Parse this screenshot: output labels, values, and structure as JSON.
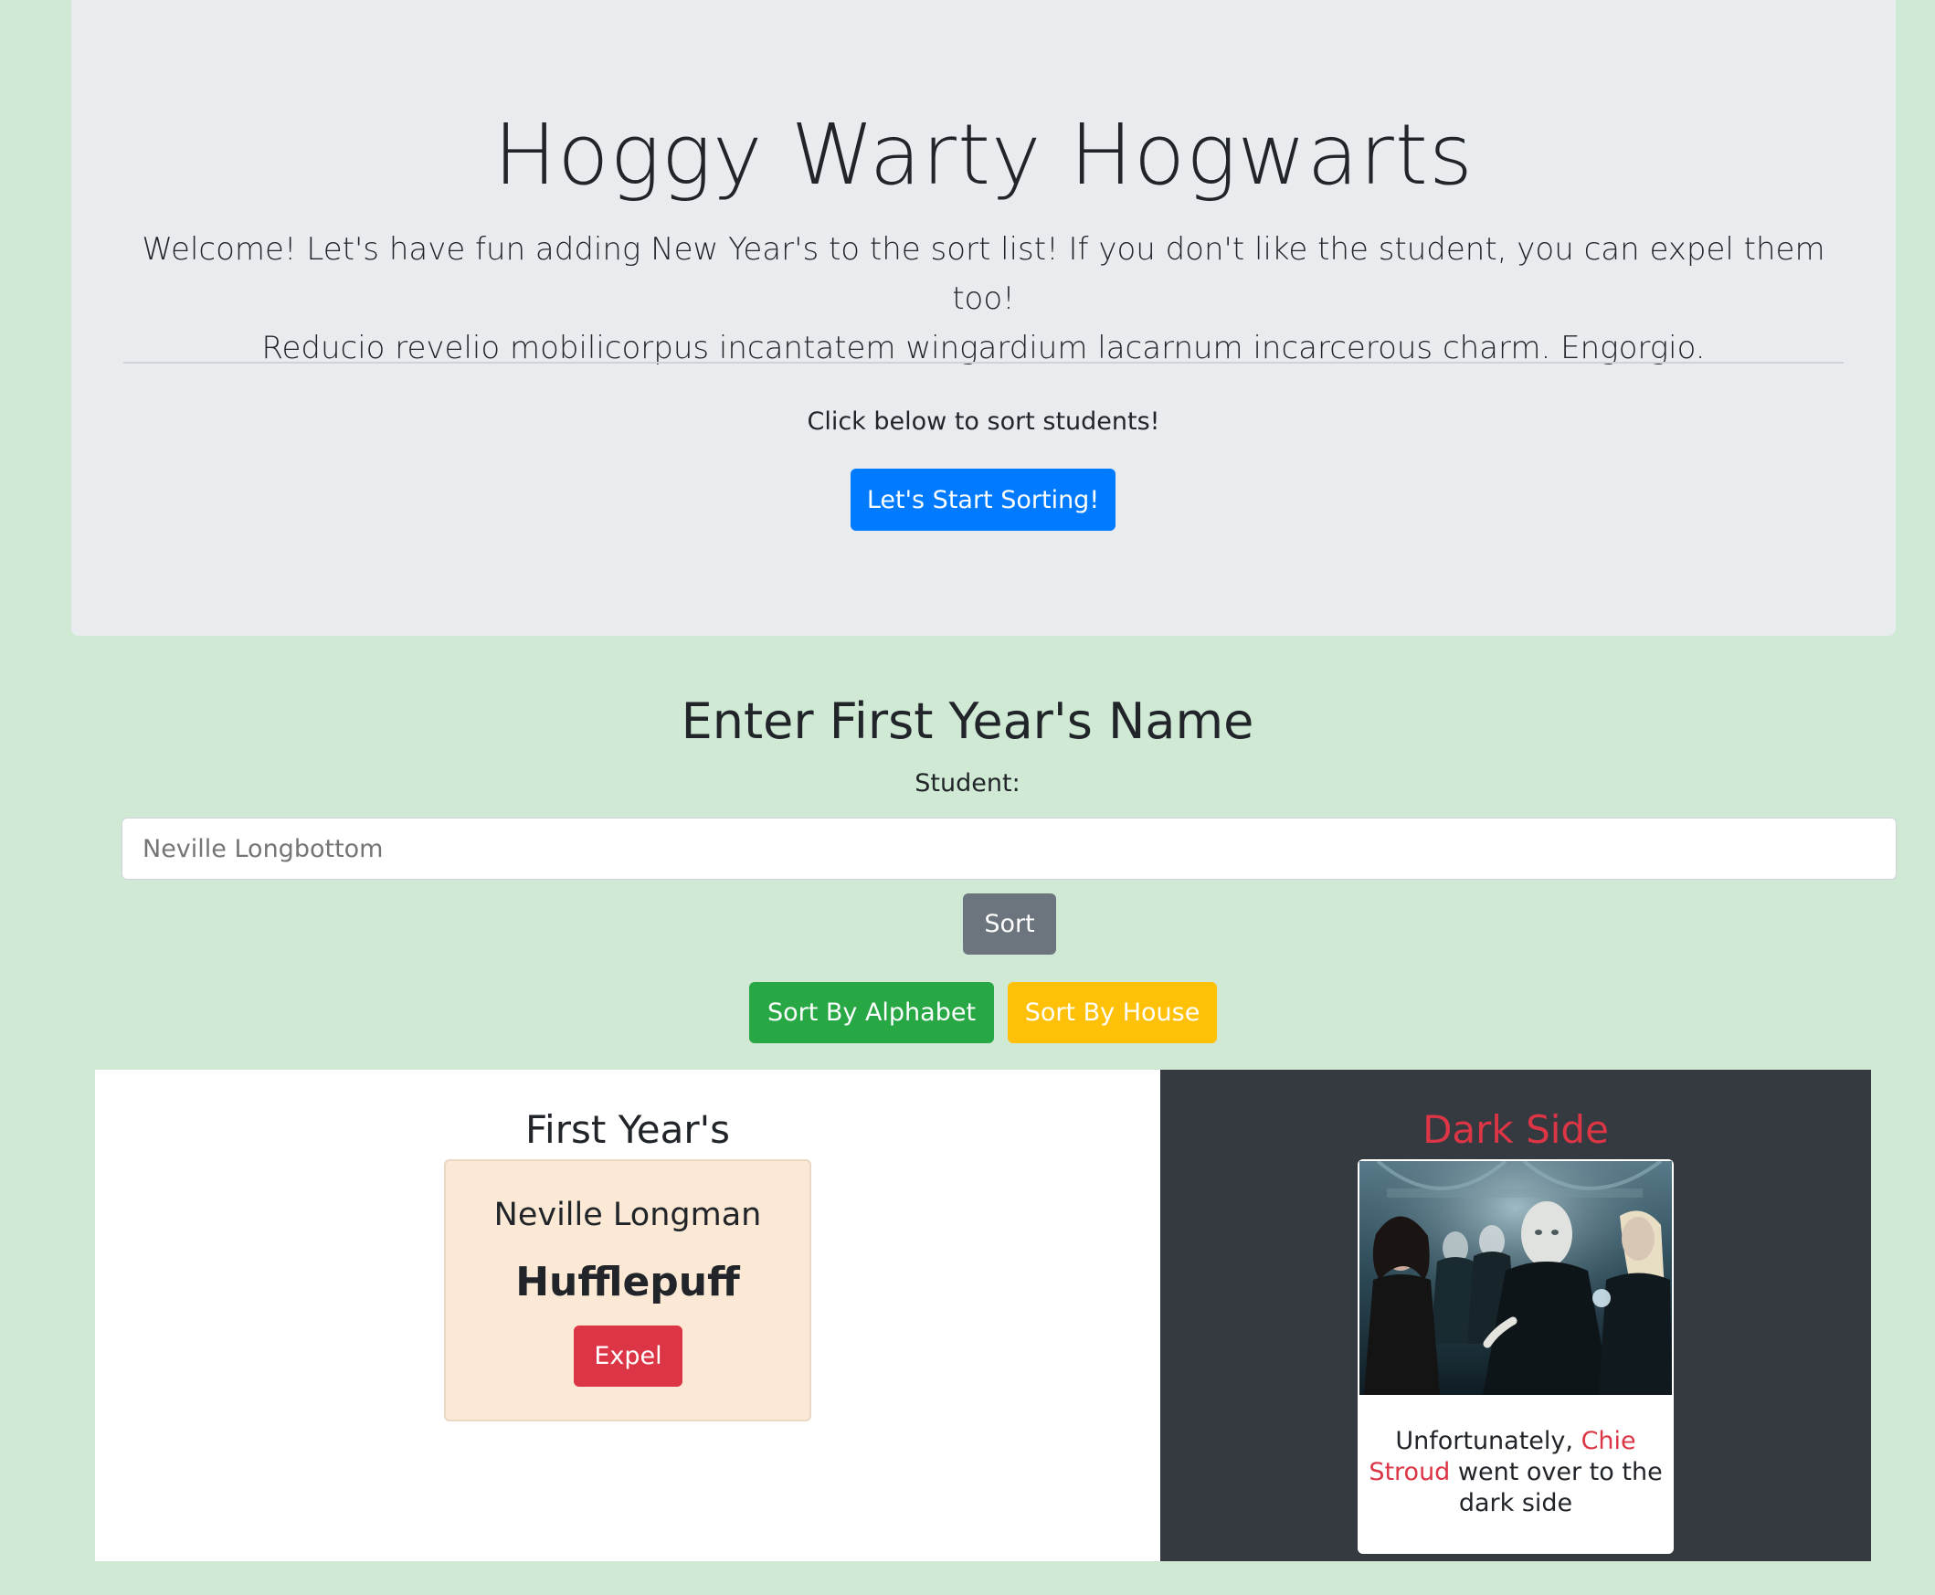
{
  "jumbotron": {
    "title": "Hoggy Warty Hogwarts",
    "lead_line1": "Welcome! Let's have fun adding New Year's to the sort list! If you don't like the student, you can expel them too!",
    "lead_line2": "Reducio revelio mobilicorpus incantatem wingardium lacarnum incarcerous charm. Engorgio.",
    "prompt": "Click below to sort students!",
    "start_button": "Let's Start Sorting!"
  },
  "form": {
    "heading": "Enter First Year's Name",
    "label": "Student:",
    "placeholder": "Neville Longbottom",
    "sort_button": "Sort"
  },
  "sort_controls": {
    "alphabet_button": "Sort By Alphabet",
    "house_button": "Sort By House"
  },
  "first_years": {
    "heading": "First Year's",
    "students": [
      {
        "name": "Neville Longman",
        "house": "Hufflepuff",
        "expel_button": "Expel",
        "card_color": "#fbe9d5"
      }
    ]
  },
  "dark_side": {
    "heading": "Dark Side",
    "heading_color": "#dc3545",
    "image_icon": "death-eaters-photo",
    "text_before": "Unfortunately, ",
    "victim_name": "Chie Stroud",
    "text_after": " went over to the dark side"
  },
  "colors": {
    "page_background": "#cfe9d4",
    "jumbotron_background": "#e9ecef",
    "primary": "#007bff",
    "secondary": "#6c757d",
    "success": "#28a745",
    "warning": "#ffc107",
    "danger": "#dc3545",
    "dark": "#343a40"
  }
}
